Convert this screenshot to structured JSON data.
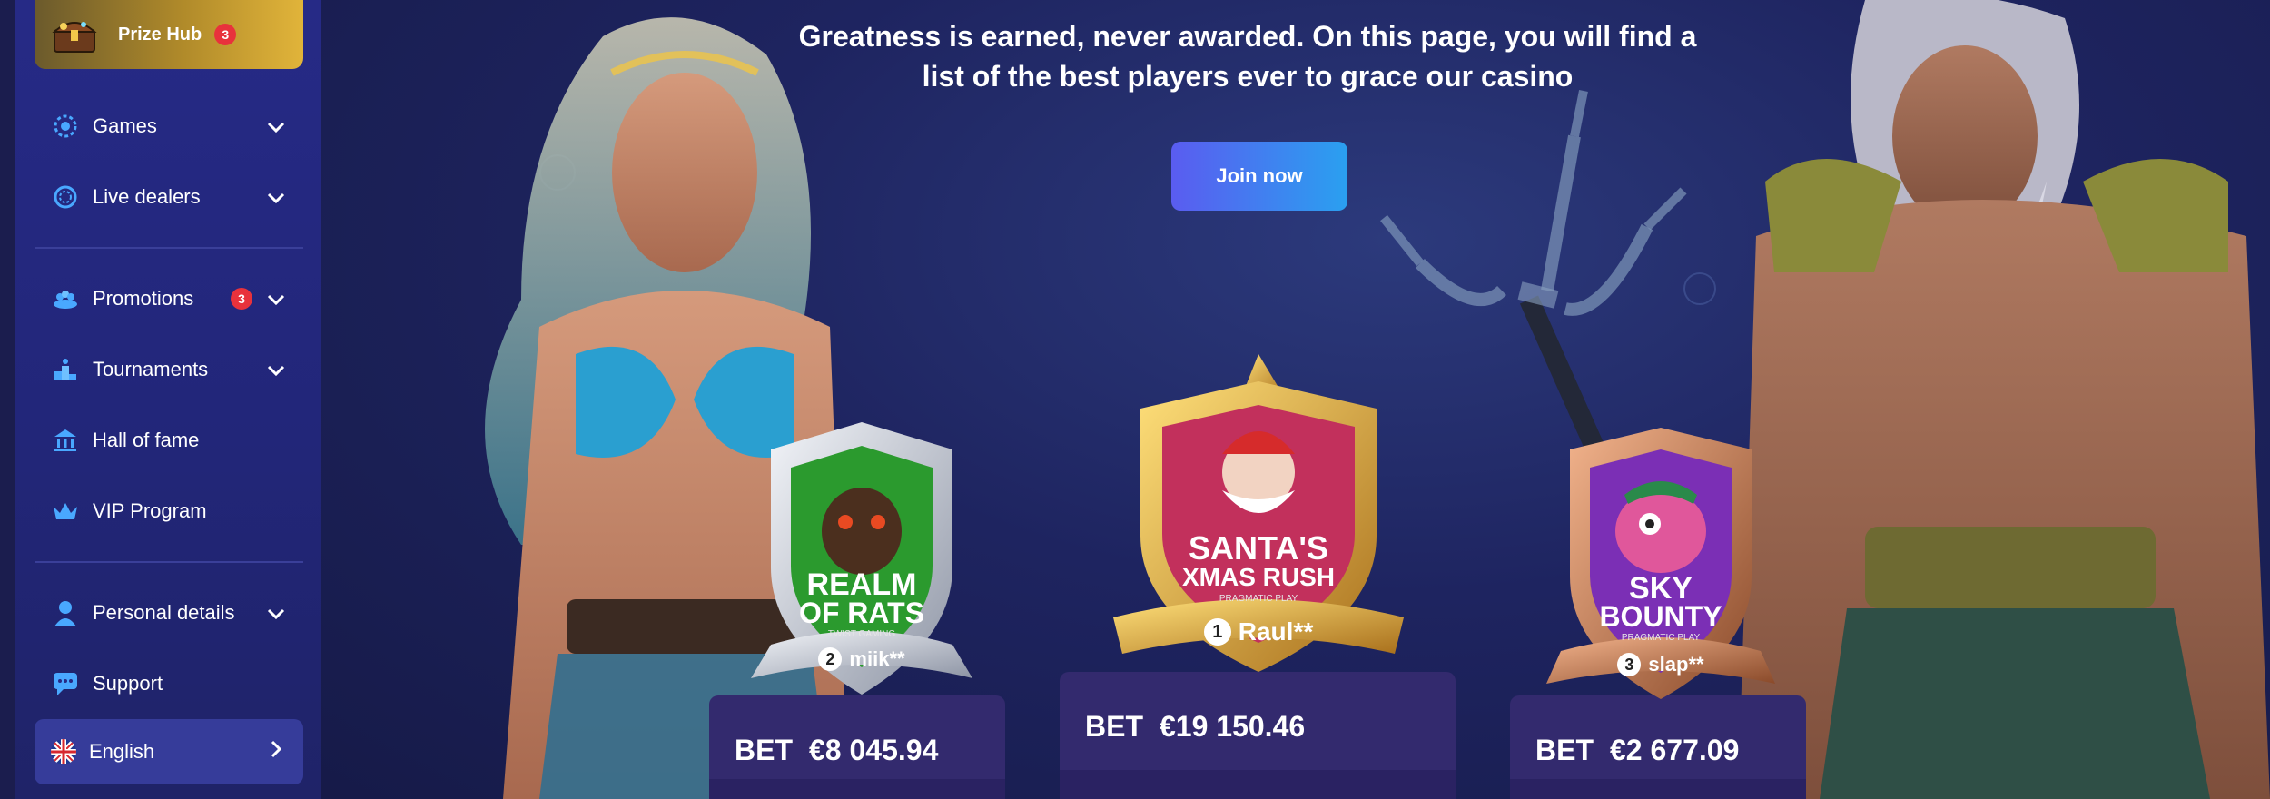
{
  "sidebar": {
    "prize_hub": {
      "label": "Prize Hub",
      "badge": "3"
    },
    "items": [
      {
        "label": "Games",
        "icon": "games-icon",
        "has_chevron": true
      },
      {
        "label": "Live dealers",
        "icon": "live-dealers-icon",
        "has_chevron": true
      },
      {
        "label": "Promotions",
        "icon": "promotions-icon",
        "has_chevron": true,
        "badge": "3"
      },
      {
        "label": "Tournaments",
        "icon": "tournaments-icon",
        "has_chevron": true
      },
      {
        "label": "Hall of fame",
        "icon": "hall-of-fame-icon",
        "has_chevron": false
      },
      {
        "label": "VIP Program",
        "icon": "crown-icon",
        "has_chevron": false
      },
      {
        "label": "Personal details",
        "icon": "person-icon",
        "has_chevron": true
      },
      {
        "label": "Support",
        "icon": "support-chat-icon",
        "has_chevron": false
      }
    ],
    "language": {
      "label": "English",
      "icon": "uk-flag-icon"
    }
  },
  "hero": {
    "headline_line1": "Greatness is earned, never awarded. On this page, you will find a",
    "headline_line2": "list of the best players ever to grace our casino",
    "cta_label": "Join now"
  },
  "podium": [
    {
      "rank": "2",
      "player": "miik**",
      "game_title_line1": "REALM",
      "game_title_line2": "OF RATS",
      "studio": "TWIST GAMING",
      "bet_label": "BET",
      "bet_amount": "€8 045.94",
      "frame": "silver"
    },
    {
      "rank": "1",
      "player": "Raul**",
      "game_title_line1": "SANTA'S",
      "game_title_line2": "XMAS RUSH",
      "studio": "PRAGMATIC PLAY",
      "bet_label": "BET",
      "bet_amount": "€19 150.46",
      "frame": "gold"
    },
    {
      "rank": "3",
      "player": "slap**",
      "game_title_line1": "SKY",
      "game_title_line2": "BOUNTY",
      "studio": "PRAGMATIC PLAY",
      "bet_label": "BET",
      "bet_amount": "€2 677.09",
      "frame": "bronze"
    }
  ],
  "colors": {
    "sidebar_bg": "#262a86",
    "main_bg": "#1e2460",
    "cta_gradient_start": "#5a5cf0",
    "cta_gradient_end": "#2aa0f0",
    "badge_red": "#e8323c",
    "card_bg": "#332a6e",
    "gold": "#e1b43a"
  }
}
